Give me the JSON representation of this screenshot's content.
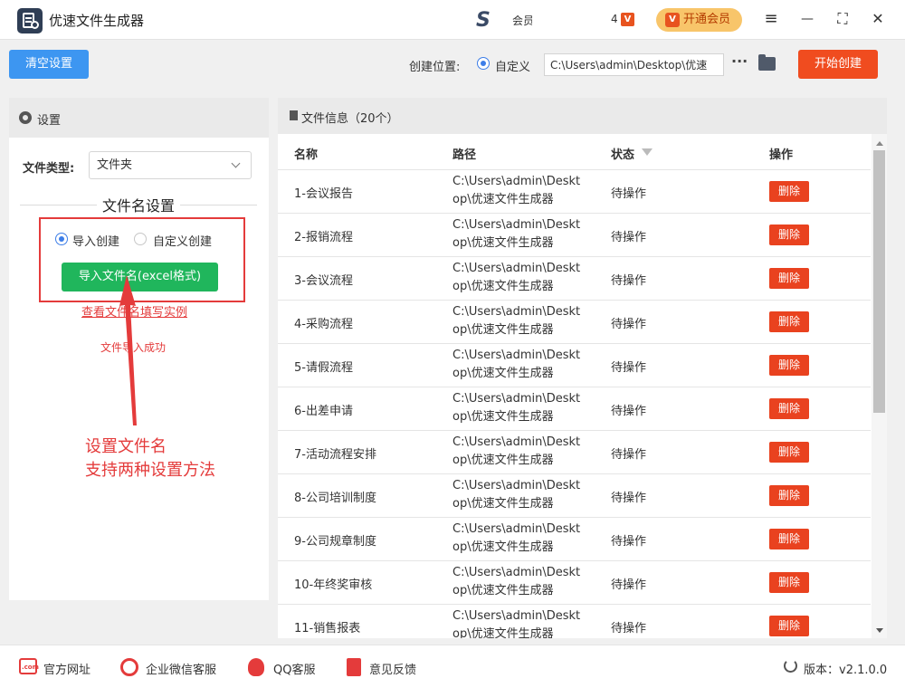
{
  "app": {
    "title": "优速文件生成器"
  },
  "titlebar": {
    "ad_text": "会员",
    "ad_number": "4",
    "ad_badge": "V",
    "vip_button": "开通会员",
    "vip_icon": "V",
    "menu_icon": "≡",
    "minimize_icon": "—",
    "maximize_icon": "⛶",
    "close_icon": "✕"
  },
  "toolbar": {
    "clear_button": "清空设置",
    "location_label": "创建位置:",
    "location_option": "自定义",
    "path_value": "C:\\Users\\admin\\Desktop\\优速",
    "more": "···",
    "start_button": "开始创建"
  },
  "settings": {
    "panel_title": "设置",
    "file_type_label": "文件类型:",
    "file_type_value": "文件夹",
    "filename_section_title": "文件名设置",
    "option_import": "导入创建",
    "option_custom": "自定义创建",
    "import_button": "导入文件名(excel格式)",
    "example_link": "查看文件名填写实例",
    "success_msg": "文件导入成功"
  },
  "annotation": {
    "line1": "设置文件名",
    "line2": "支持两种设置方法",
    "color": "#e43b3b"
  },
  "file_info": {
    "title": "文件信息（20个）",
    "columns": {
      "name": "名称",
      "path": "路径",
      "status": "状态",
      "action": "操作"
    },
    "rows": [
      {
        "name": "1-会议报告",
        "path": "C:\\Users\\admin\\Desktop\\优速文件生成器",
        "status": "待操作",
        "action": "删除"
      },
      {
        "name": "2-报销流程",
        "path": "C:\\Users\\admin\\Desktop\\优速文件生成器",
        "status": "待操作",
        "action": "删除"
      },
      {
        "name": "3-会议流程",
        "path": "C:\\Users\\admin\\Desktop\\优速文件生成器",
        "status": "待操作",
        "action": "删除"
      },
      {
        "name": "4-采购流程",
        "path": "C:\\Users\\admin\\Desktop\\优速文件生成器",
        "status": "待操作",
        "action": "删除"
      },
      {
        "name": "5-请假流程",
        "path": "C:\\Users\\admin\\Desktop\\优速文件生成器",
        "status": "待操作",
        "action": "删除"
      },
      {
        "name": "6-出差申请",
        "path": "C:\\Users\\admin\\Desktop\\优速文件生成器",
        "status": "待操作",
        "action": "删除"
      },
      {
        "name": "7-活动流程安排",
        "path": "C:\\Users\\admin\\Desktop\\优速文件生成器",
        "status": "待操作",
        "action": "删除"
      },
      {
        "name": "8-公司培训制度",
        "path": "C:\\Users\\admin\\Desktop\\优速文件生成器",
        "status": "待操作",
        "action": "删除"
      },
      {
        "name": "9-公司规章制度",
        "path": "C:\\Users\\admin\\Desktop\\优速文件生成器",
        "status": "待操作",
        "action": "删除"
      },
      {
        "name": "10-年终奖审核",
        "path": "C:\\Users\\admin\\Desktop\\优速文件生成器",
        "status": "待操作",
        "action": "删除"
      },
      {
        "name": "11-销售报表",
        "path": "C:\\Users\\admin\\Desktop\\优速文件生成器",
        "status": "待操作",
        "action": "删除"
      }
    ]
  },
  "footer": {
    "website": "官方网址",
    "web_icon_text": ".com",
    "wechat": "企业微信客服",
    "qq": "QQ客服",
    "feedback": "意见反馈",
    "version": "版本：v2.1.0.0"
  },
  "colors": {
    "primary_blue": "#3d96f1",
    "start_orange": "#f04c1f",
    "import_green": "#20b65c",
    "delete_red": "#e9421f",
    "vip_gold": "#f8c56a"
  }
}
